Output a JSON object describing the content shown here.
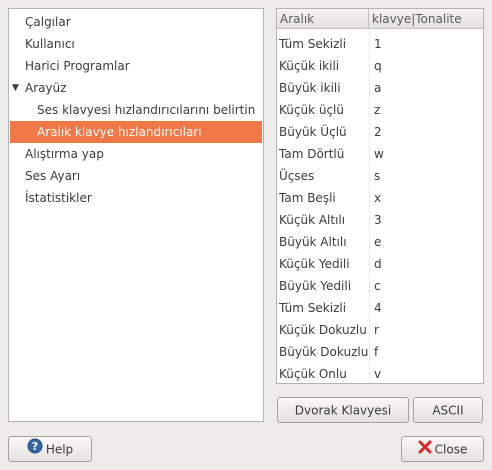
{
  "tree": {
    "items": [
      {
        "label": "Çalgılar"
      },
      {
        "label": "Kullanıcı"
      },
      {
        "label": "Harici Programlar"
      },
      {
        "label": "Arayüz",
        "expander": "▼"
      },
      {
        "label": "Ses klavyesi hızlandırıcılarını belirtin"
      },
      {
        "label": "Aralık klavye hızlandırıcıları"
      },
      {
        "label": "Alıştırma yap"
      },
      {
        "label": "Ses Ayarı"
      },
      {
        "label": "İstatistikler"
      }
    ]
  },
  "table": {
    "headers": [
      "Aralık",
      "klavye|Tonalite"
    ],
    "rows": [
      [
        "Tüm Sekizli",
        "1"
      ],
      [
        "Küçük ikili",
        "q"
      ],
      [
        "Büyük ikili",
        "a"
      ],
      [
        "Küçük üçlü",
        "z"
      ],
      [
        "Büyük Üçlü",
        "2"
      ],
      [
        "Tam Dörtlü",
        "w"
      ],
      [
        "Üçses",
        "s"
      ],
      [
        "Tam Beşli",
        "x"
      ],
      [
        "Küçük Altılı",
        "3"
      ],
      [
        "Büyük Altılı",
        "e"
      ],
      [
        "Küçük Yedili",
        "d"
      ],
      [
        "Büyük Yedili",
        "c"
      ],
      [
        "Tüm Sekizli",
        "4"
      ],
      [
        "Küçük Dokuzlu",
        "r"
      ],
      [
        "Büyük Dokuzlu",
        "f"
      ],
      [
        "Küçük Onlu",
        "v"
      ]
    ]
  },
  "buttons": {
    "dvorak": "Dvorak Klavyesi",
    "ascii": "ASCII",
    "help": "Help",
    "close": "Close"
  },
  "icons": {
    "help": "help-icon",
    "close": "close-icon"
  },
  "colors": {
    "selection": "#f07746",
    "window_bg": "#edeceb",
    "close_icon": "#d8282a",
    "help_icon": "#3465a4"
  }
}
